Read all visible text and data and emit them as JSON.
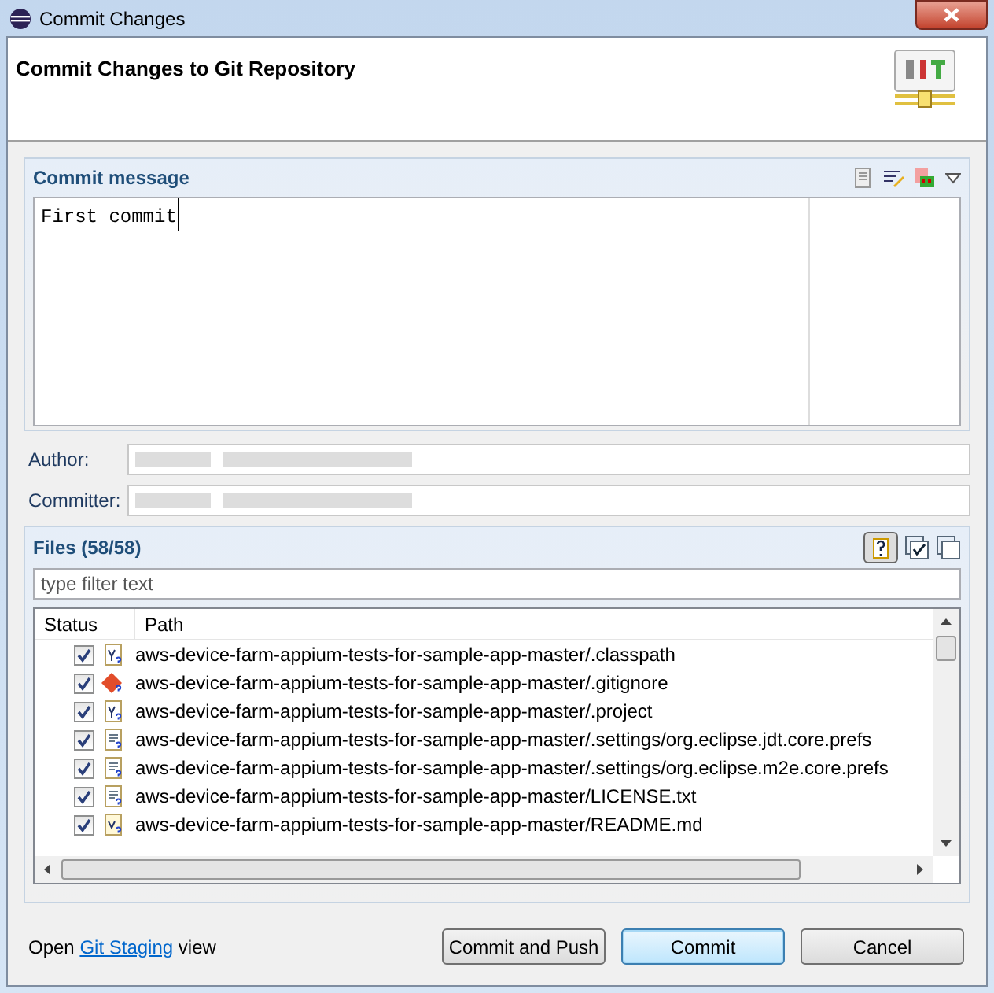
{
  "window": {
    "title": "Commit Changes"
  },
  "header": {
    "title": "Commit Changes to Git Repository"
  },
  "commit_message": {
    "title": "Commit message",
    "value": "First commit"
  },
  "author": {
    "label": "Author:"
  },
  "committer": {
    "label": "Committer:"
  },
  "files": {
    "title": "Files (58/58)",
    "filter_placeholder": "type filter text",
    "columns": [
      "Status",
      "Path"
    ],
    "rows": [
      {
        "checked": true,
        "kind": "xml",
        "path": "aws-device-farm-appium-tests-for-sample-app-master/.classpath"
      },
      {
        "checked": true,
        "kind": "git",
        "path": "aws-device-farm-appium-tests-for-sample-app-master/.gitignore"
      },
      {
        "checked": true,
        "kind": "xml",
        "path": "aws-device-farm-appium-tests-for-sample-app-master/.project"
      },
      {
        "checked": true,
        "kind": "text",
        "path": "aws-device-farm-appium-tests-for-sample-app-master/.settings/org.eclipse.jdt.core.prefs"
      },
      {
        "checked": true,
        "kind": "text",
        "path": "aws-device-farm-appium-tests-for-sample-app-master/.settings/org.eclipse.m2e.core.prefs"
      },
      {
        "checked": true,
        "kind": "text",
        "path": "aws-device-farm-appium-tests-for-sample-app-master/LICENSE.txt"
      },
      {
        "checked": true,
        "kind": "md",
        "path": "aws-device-farm-appium-tests-for-sample-app-master/README.md"
      }
    ]
  },
  "footer": {
    "prefix": "Open",
    "link": "Git Staging",
    "suffix": "view"
  },
  "buttons": [
    {
      "label": "Commit and Push",
      "default": false
    },
    {
      "label": "Commit",
      "default": true
    },
    {
      "label": "Cancel",
      "default": false
    }
  ]
}
